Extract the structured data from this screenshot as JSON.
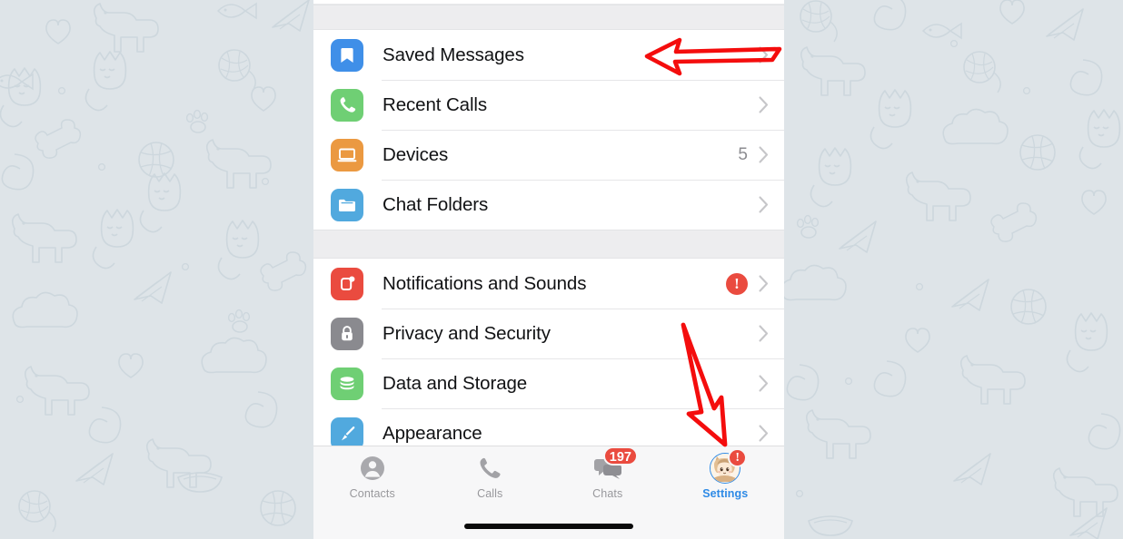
{
  "app": {
    "name": "Telegram",
    "screen_title": "Settings",
    "wallpaper": "cats-and-dogs-doodle-pattern",
    "wallpaper_color": "#dee4e8",
    "panel_background": "#ffffff",
    "section_gap_color": "#ededef"
  },
  "settings": {
    "groups": [
      {
        "id": "account-group",
        "rows": [
          {
            "label": "Saved Messages",
            "icon": "bookmark-icon",
            "icon_color": "#3f8fe8",
            "value": "",
            "badge": "",
            "chevron": true
          },
          {
            "label": "Recent Calls",
            "icon": "phone-handset-icon",
            "icon_color": "#6fcf74",
            "value": "",
            "badge": "",
            "chevron": true
          },
          {
            "label": "Devices",
            "icon": "laptop-icon",
            "icon_color": "#eb9941",
            "value": "5",
            "badge": "",
            "chevron": true
          },
          {
            "label": "Chat Folders",
            "icon": "folder-icon",
            "icon_color": "#51a9de",
            "value": "",
            "badge": "",
            "chevron": true
          }
        ]
      },
      {
        "id": "preferences-group",
        "rows": [
          {
            "label": "Notifications and Sounds",
            "icon": "notifications-bell-icon",
            "icon_color": "#ea4b3f",
            "value": "",
            "badge": "!",
            "chevron": true
          },
          {
            "label": "Privacy and Security",
            "icon": "lock-icon",
            "icon_color": "#8a8a8f",
            "value": "",
            "badge": "",
            "chevron": true
          },
          {
            "label": "Data and Storage",
            "icon": "database-icon",
            "icon_color": "#6fcf74",
            "value": "",
            "badge": "",
            "chevron": true
          },
          {
            "label": "Appearance",
            "icon": "paintbrush-icon",
            "icon_color": "#51a9de",
            "value": "",
            "badge": "",
            "chevron": true
          }
        ]
      }
    ]
  },
  "tabbar": {
    "active_tab": "Settings",
    "active_color": "#2e8ae6",
    "inactive_color": "#98989c",
    "tabs": [
      {
        "label": "Contacts",
        "icon": "person-circle-icon",
        "badge": ""
      },
      {
        "label": "Calls",
        "icon": "phone-handset-icon",
        "badge": ""
      },
      {
        "label": "Chats",
        "icon": "chat-bubbles-icon",
        "badge": "197"
      },
      {
        "label": "Settings",
        "icon": "user-avatar-icon",
        "badge": "!"
      }
    ]
  },
  "annotations": [
    {
      "id": "arrow-pointing-at-saved-messages",
      "type": "left-arrow",
      "color": "#f40d0d",
      "target": "Saved Messages"
    },
    {
      "id": "arrow-pointing-at-settings-tab",
      "type": "down-arrow",
      "color": "#f40d0d",
      "target": "Settings"
    }
  ]
}
